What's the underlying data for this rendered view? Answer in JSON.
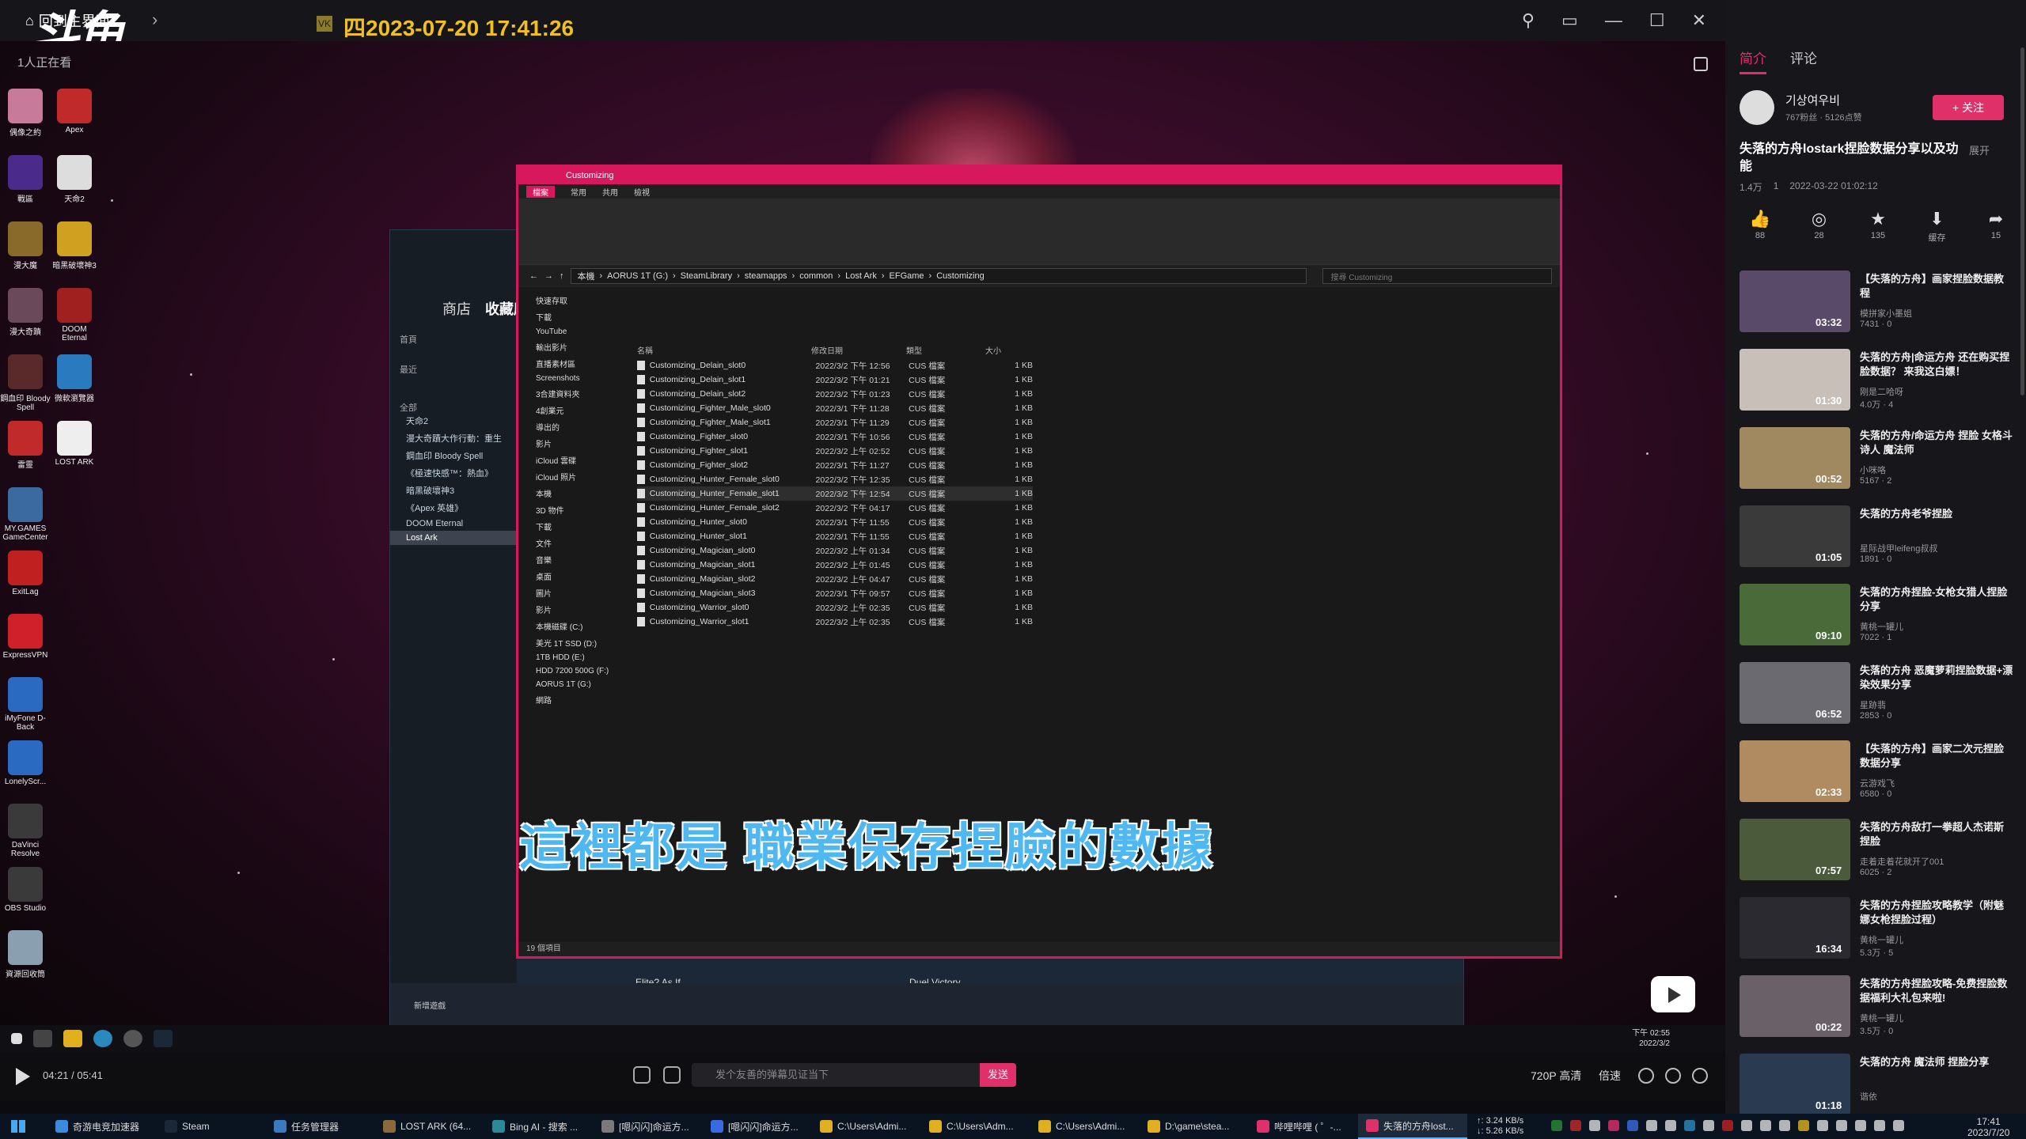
{
  "player": {
    "back_label": "回到主界面",
    "brand": "斗鱼",
    "video_title": "四2023-07-20 17:41:26",
    "title_badge": "VK",
    "watching": "1人正在看"
  },
  "recording": {
    "desktop_icons": [
      "偶像之約",
      "Apex",
      "戰區",
      "天命2",
      "漫大魔",
      "暗黑破壞神3",
      "漫大奇蹟",
      "DOOM Eternal",
      "鋼血印 Bloody Spell",
      "微軟瀏覽器",
      "雷靈",
      "LOST ARK",
      "MY.GAMES GameCenter",
      "ExitLag",
      "ExpressVPN",
      "iMyFone D-Back",
      "LonelyScr...",
      "DaVinci Resolve",
      "OBS Studio",
      "資源回收筒"
    ],
    "steam": {
      "store": "商店",
      "library": "收藏庫",
      "home": "首頁",
      "recent": "最近",
      "all_label": "全部",
      "games": [
        "天命2",
        "漫大奇蹟大作行動：重生",
        "鋼血印 Bloody Spell",
        "《極速快感™：熱血》",
        "暗黑破壞神3",
        "《Apex 英雄》",
        "DOOM Eternal",
        "Lost Ark"
      ],
      "activity1": "Elite? As If",
      "activity2": "Duel Victory",
      "add_game": "新增遊戲"
    },
    "explorer": {
      "title": "Customizing",
      "ribbon_tabs": [
        "檔案",
        "常用",
        "共用",
        "檢視"
      ],
      "path": [
        "本機",
        "AORUS 1T (G:)",
        "SteamLibrary",
        "steamapps",
        "common",
        "Lost Ark",
        "EFGame",
        "Customizing"
      ],
      "search_placeholder": "搜尋 Customizing",
      "nav": [
        "快速存取",
        "下載",
        "YouTube",
        "輸出影片",
        "直播素材區",
        "Screenshots",
        "3合建資料夾",
        "4創業元",
        "導出的",
        "影片",
        "iCloud 雲碟",
        "iCloud 照片",
        "本機",
        "3D 物件",
        "下載",
        "文件",
        "音樂",
        "桌面",
        "圖片",
        "影片",
        "本機磁碟 (C:)",
        "美光 1T SSD (D:)",
        "1TB HDD (E:)",
        "HDD 7200 500G (F:)",
        "AORUS 1T (G:)",
        "網路"
      ],
      "columns": [
        "名稱",
        "修改日期",
        "類型",
        "大小"
      ],
      "files": [
        [
          "Customizing_Delain_slot0",
          "2022/3/2 下午 12:56",
          "CUS 檔案",
          "1 KB"
        ],
        [
          "Customizing_Delain_slot1",
          "2022/3/2 下午 01:21",
          "CUS 檔案",
          "1 KB"
        ],
        [
          "Customizing_Delain_slot2",
          "2022/3/2 下午 01:23",
          "CUS 檔案",
          "1 KB"
        ],
        [
          "Customizing_Fighter_Male_slot0",
          "2022/3/1 下午 11:28",
          "CUS 檔案",
          "1 KB"
        ],
        [
          "Customizing_Fighter_Male_slot1",
          "2022/3/1 下午 11:29",
          "CUS 檔案",
          "1 KB"
        ],
        [
          "Customizing_Fighter_slot0",
          "2022/3/1 下午 10:56",
          "CUS 檔案",
          "1 KB"
        ],
        [
          "Customizing_Fighter_slot1",
          "2022/3/2 上午 02:52",
          "CUS 檔案",
          "1 KB"
        ],
        [
          "Customizing_Fighter_slot2",
          "2022/3/1 下午 11:27",
          "CUS 檔案",
          "1 KB"
        ],
        [
          "Customizing_Hunter_Female_slot0",
          "2022/3/2 下午 12:35",
          "CUS 檔案",
          "1 KB"
        ],
        [
          "Customizing_Hunter_Female_slot1",
          "2022/3/2 下午 12:54",
          "CUS 檔案",
          "1 KB"
        ],
        [
          "Customizing_Hunter_Female_slot2",
          "2022/3/2 下午 04:17",
          "CUS 檔案",
          "1 KB"
        ],
        [
          "Customizing_Hunter_slot0",
          "2022/3/1 下午 11:55",
          "CUS 檔案",
          "1 KB"
        ],
        [
          "Customizing_Hunter_slot1",
          "2022/3/1 下午 11:55",
          "CUS 檔案",
          "1 KB"
        ],
        [
          "Customizing_Magician_slot0",
          "2022/3/2 上午 01:34",
          "CUS 檔案",
          "1 KB"
        ],
        [
          "Customizing_Magician_slot1",
          "2022/3/2 上午 01:45",
          "CUS 檔案",
          "1 KB"
        ],
        [
          "Customizing_Magician_slot2",
          "2022/3/2 上午 04:47",
          "CUS 檔案",
          "1 KB"
        ],
        [
          "Customizing_Magician_slot3",
          "2022/3/1 下午 09:57",
          "CUS 檔案",
          "1 KB"
        ],
        [
          "Customizing_Warrior_slot0",
          "2022/3/2 上午 02:35",
          "CUS 檔案",
          "1 KB"
        ],
        [
          "Customizing_Warrior_slot1",
          "2022/3/2 上午 02:35",
          "CUS 檔案",
          "1 KB"
        ]
      ],
      "status": "19 個項目"
    },
    "subtitle": "這裡都是 職業保存捏臉的數據",
    "inner_clock_time": "下午 02:55",
    "inner_clock_date": "2022/3/2"
  },
  "controls": {
    "time": "04:21 / 05:41",
    "danmaku_placeholder": "发个友善的弹幕见证当下",
    "send": "发送",
    "quality": "720P 高清",
    "speed": "倍速"
  },
  "sidebar": {
    "tab_intro": "简介",
    "tab_comments": "评论",
    "author": "기상여우비",
    "author_stats": "767粉丝 · 5126点赞",
    "follow": "+ 关注",
    "title": "失落的方舟lostark捏脸数据分享以及功能",
    "expand": "展开",
    "views": "1.4万",
    "danmaku_count": "1",
    "date": "2022-03-22 01:02:12",
    "actions": [
      {
        "icon": "👍",
        "count": "88"
      },
      {
        "icon": "◎",
        "count": "28"
      },
      {
        "icon": "★",
        "count": "135"
      },
      {
        "icon": "⬇",
        "count": "缓存"
      },
      {
        "icon": "➦",
        "count": "15"
      }
    ],
    "recs": [
      {
        "title": "【失落的方舟】画家捏脸数据教程",
        "uploader": "模拼家小墨姐",
        "stats": "7431 · 0",
        "dur": "03:32",
        "color": "#5a4a6a"
      },
      {
        "title": "失落的方舟|命运方舟 还在购买捏脸数据？ 来我这白嫖！",
        "uploader": "刚是二哈呀",
        "stats": "4.0万 · 4",
        "dur": "01:30",
        "color": "#c8c0b8"
      },
      {
        "title": "失落的方舟/命运方舟 捏脸 女格斗 诗人 魔法师",
        "uploader": "小咪咯",
        "stats": "5167 · 2",
        "dur": "00:52",
        "color": "#a08860"
      },
      {
        "title": "失落的方舟老爷捏脸",
        "uploader": "星际战甲leifeng叔叔",
        "stats": "1891 · 0",
        "dur": "01:05",
        "color": "#3a3a3a"
      },
      {
        "title": "失落的方舟捏脸-女枪女猎人捏脸分享",
        "uploader": "黄桃一罐儿",
        "stats": "7022 · 1",
        "dur": "09:10",
        "color": "#4a6a3a"
      },
      {
        "title": "失落的方舟 恶魔萝莉捏脸数据+漂染效果分享",
        "uploader": "星跡翡",
        "stats": "2853 · 0",
        "dur": "06:52",
        "color": "#6a6a70"
      },
      {
        "title": "【失落的方舟】画家二次元捏脸数据分享",
        "uploader": "云游戏飞",
        "stats": "6580 · 0",
        "dur": "02:33",
        "color": "#b08a60"
      },
      {
        "title": "失落的方舟敌打一拳超人杰诺斯捏脸",
        "uploader": "走着走着花就开了001",
        "stats": "6025 · 2",
        "dur": "07:57",
        "color": "#4a5a3a"
      },
      {
        "title": "失落的方舟捏脸攻略教学（附魅娜女枪捏脸过程）",
        "uploader": "黄桃一罐儿",
        "stats": "5.3万 · 5",
        "dur": "16:34",
        "color": "#2a2a30"
      },
      {
        "title": "失落的方舟捏脸攻略-免费捏脸数据福利大礼包来啦!",
        "uploader": "黄桃一罐儿",
        "stats": "3.5万 · 0",
        "dur": "00:22",
        "color": "#6a6068"
      },
      {
        "title": "失落的方舟 魔法师 捏脸分享",
        "uploader": "谐依",
        "stats": "",
        "dur": "01:18",
        "color": "#2a3a50"
      }
    ]
  },
  "taskbar": {
    "apps": [
      {
        "label": "奇游电竞加速器",
        "color": "#3a8ae0"
      },
      {
        "label": "Steam",
        "color": "#1b2838"
      },
      {
        "label": "任务管理器",
        "color": "#3a7ac0"
      },
      {
        "label": "LOST ARK (64...",
        "color": "#8a6a3a"
      },
      {
        "label": "Bing AI - 搜索 ...",
        "color": "#2a8a9a"
      },
      {
        "label": "[嗯闪闪]命运方...",
        "color": "#7a7a7a"
      },
      {
        "label": "[嗯闪闪]命运方...",
        "color": "#3a6ae0"
      },
      {
        "label": "C:\\Users\\Admi...",
        "color": "#e0b020"
      },
      {
        "label": "C:\\Users\\Adm...",
        "color": "#e0b020"
      },
      {
        "label": "C:\\Users\\Admi...",
        "color": "#e0b020"
      },
      {
        "label": "D:\\game\\stea...",
        "color": "#e0b020"
      },
      {
        "label": "哔哩哔哩 ( ゜-...",
        "color": "#e0306a"
      },
      {
        "label": "失落的方舟lost...",
        "color": "#e0306a"
      }
    ],
    "net_up": "↑: 3.24 KB/s",
    "net_down": "↓: 5.26 KB/s",
    "time": "17:41",
    "date": "2023/7/20"
  }
}
